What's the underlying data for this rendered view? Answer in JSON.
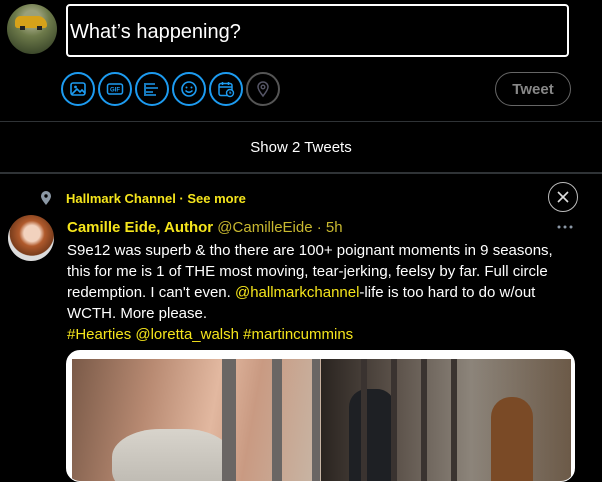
{
  "composer": {
    "placeholder": "What’s happening?",
    "tweet_button": "Tweet",
    "tools": [
      "image-icon",
      "gif-icon",
      "poll-icon",
      "emoji-icon",
      "schedule-icon",
      "location-icon"
    ]
  },
  "timeline": {
    "show_tweets": "Show 2 Tweets"
  },
  "tweet": {
    "topic": "Hallmark Channel · See more",
    "name": "Camille Eide, Author",
    "handle_time": " @CamilleEide · 5h",
    "text_part1": "S9e12 was superb & tho there are 100+ poignant moments in 9 seasons, this for me is 1 of THE most moving, tear-jerking, feelsy by far. Full circle redemption. I can't even. ",
    "mention": "@hallmarkchannel",
    "text_part2": "-life is too hard to do w/out WCTH. More please.",
    "hashtags": "#Hearties @loretta_walsh #martincummins"
  },
  "colors": {
    "accent": "#1d9bf0",
    "highlight": "#f5e51c",
    "background": "#000000"
  }
}
